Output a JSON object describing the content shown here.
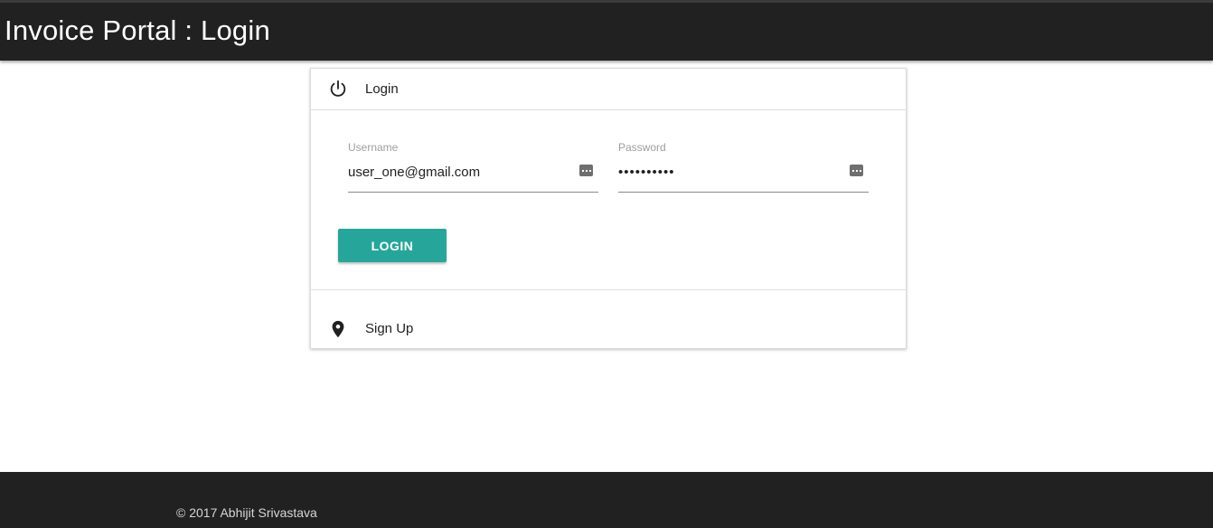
{
  "header": {
    "title": "Invoice Portal : Login"
  },
  "login_section": {
    "label": "Login",
    "icon": "power-icon",
    "username": {
      "label": "Username",
      "value": "user_one@gmail.com"
    },
    "password": {
      "label": "Password",
      "value": "••••••••••"
    },
    "button_label": "LOGIN"
  },
  "signup_section": {
    "label": "Sign Up",
    "icon": "location-pin-icon"
  },
  "footer": {
    "text": "© 2017 Abhijit Srivastava"
  },
  "colors": {
    "header_bg": "#212121",
    "accent": "#26a69a",
    "footer_bg": "#212121"
  }
}
